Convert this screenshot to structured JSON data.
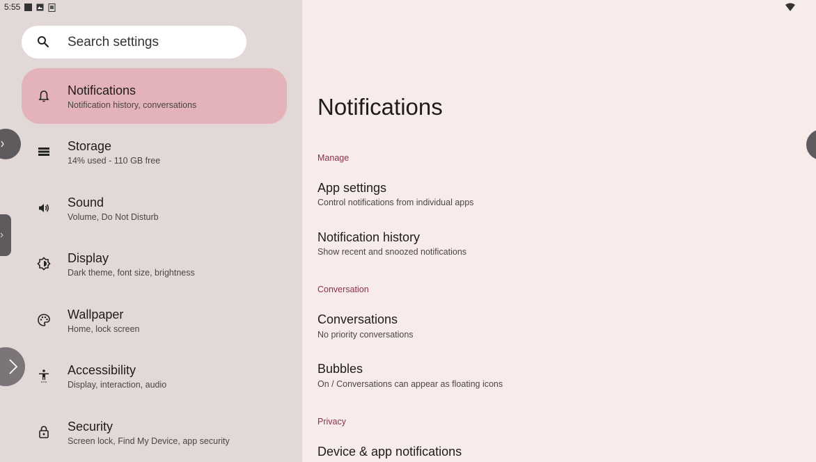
{
  "status_bar": {
    "time": "5:55"
  },
  "search": {
    "placeholder": "Search settings"
  },
  "menu": [
    {
      "title": "Notifications",
      "subtitle": "Notification history, conversations",
      "icon": "bell-icon",
      "selected": true
    },
    {
      "title": "Storage",
      "subtitle": "14% used - 110 GB free",
      "icon": "storage-icon"
    },
    {
      "title": "Sound",
      "subtitle": "Volume, Do Not Disturb",
      "icon": "speaker-icon"
    },
    {
      "title": "Display",
      "subtitle": "Dark theme, font size, brightness",
      "icon": "brightness-icon"
    },
    {
      "title": "Wallpaper",
      "subtitle": "Home, lock screen",
      "icon": "palette-icon"
    },
    {
      "title": "Accessibility",
      "subtitle": "Display, interaction, audio",
      "icon": "accessibility-icon"
    },
    {
      "title": "Security",
      "subtitle": "Screen lock, Find My Device, app security",
      "icon": "lock-icon"
    }
  ],
  "detail": {
    "title": "Notifications",
    "sections": {
      "manage": "Manage",
      "conversation": "Conversation",
      "privacy": "Privacy"
    },
    "items": {
      "app_settings": {
        "title": "App settings",
        "subtitle": "Control notifications from individual apps"
      },
      "notification_history": {
        "title": "Notification history",
        "subtitle": "Show recent and snoozed notifications"
      },
      "conversations": {
        "title": "Conversations",
        "subtitle": "No priority conversations"
      },
      "bubbles": {
        "title": "Bubbles",
        "subtitle": "On / Conversations can appear as floating icons"
      },
      "device_app_notifications": {
        "title": "Device & app notifications"
      }
    }
  },
  "colors": {
    "accent": "#8a3048",
    "selected_bg": "#e3b3b9",
    "left_bg": "#e2d8d8",
    "right_bg": "#f8eceb"
  }
}
